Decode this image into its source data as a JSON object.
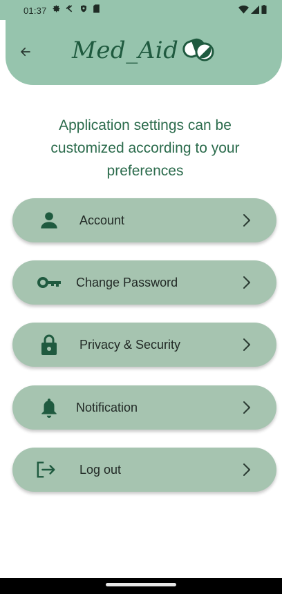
{
  "status_bar": {
    "time": "01:37",
    "left_icons": [
      "gear-icon",
      "cast-icon",
      "shield-icon",
      "sd-card-icon"
    ],
    "right_icons": [
      "wifi-icon",
      "signal-icon",
      "battery-icon"
    ]
  },
  "header": {
    "back_icon": "arrow-left-icon",
    "brand_text": "Med_Aid",
    "brand_icon": "pill-icon",
    "background": "#96c4ad"
  },
  "intro_text": "Application settings can be customized according to your preferences",
  "menu": {
    "items": [
      {
        "label": "Account",
        "icon": "person-icon"
      },
      {
        "label": "Change Password",
        "icon": "key-icon"
      },
      {
        "label": "Privacy & Security",
        "icon": "lock-icon"
      },
      {
        "label": "Notification",
        "icon": "bell-icon"
      },
      {
        "label": "Log out",
        "icon": "logout-icon"
      }
    ],
    "chevron_icon": "chevron-right-icon",
    "item_color": "#a6c4b0",
    "icon_color": "#1f5a3f"
  }
}
